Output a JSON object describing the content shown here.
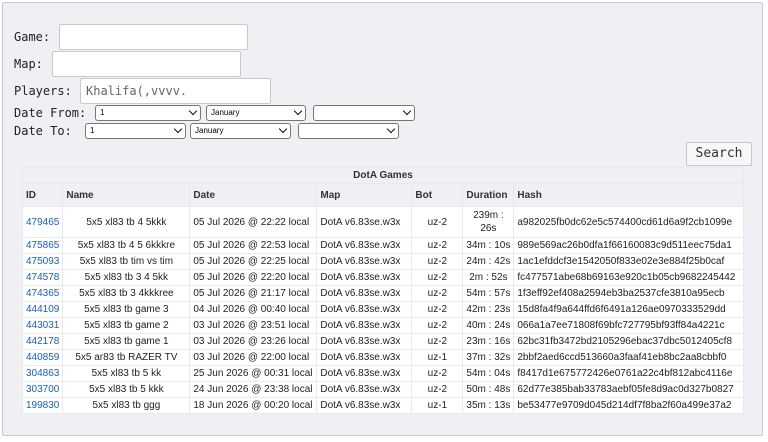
{
  "form": {
    "game_label": "Game:",
    "map_label": "Map:",
    "players_label": "Players:",
    "players_value": "Khalifa(,vvvv.",
    "date_from_label": "Date From:",
    "date_to_label": "Date To:",
    "date_from": {
      "day": "1",
      "month": "January",
      "year": ""
    },
    "date_to": {
      "day": "1",
      "month": "January",
      "year": ""
    },
    "search_label": "Search"
  },
  "table": {
    "caption": "DotA Games",
    "headers": {
      "id": "ID",
      "name": "Name",
      "date": "Date",
      "map": "Map",
      "bot": "Bot",
      "duration": "Duration",
      "hash": "Hash"
    },
    "rows": [
      {
        "id": "479465",
        "name": "5x5 xl83 tb 4 5kkk",
        "date": "05 Jul 2026 @ 22:22 local",
        "map": "DotA v6.83se.w3x",
        "bot": "uz-2",
        "duration": "239m :\n26s",
        "hash": "a982025fb0dc62e5c574400cd61d6a9f2cb1099e"
      },
      {
        "id": "475865",
        "name": "5x5 xl83 tb 4 5 6kkkre",
        "date": "05 Jul 2026 @ 22:53 local",
        "map": "DotA v6.83se.w3x",
        "bot": "uz-2",
        "duration": "34m : 10s",
        "hash": "989e569ac26b0dfa1f66160083c9d511eec75da1"
      },
      {
        "id": "475093",
        "name": "5x5 xl83 tb tim vs tim",
        "date": "05 Jul 2026 @ 22:25 local",
        "map": "DotA v6.83se.w3x",
        "bot": "uz-2",
        "duration": "24m : 42s",
        "hash": "1ac1efddcf3e1542050f833e02e3e884f25b0caf"
      },
      {
        "id": "474578",
        "name": "5x5 xl83 tb 3 4 5kk",
        "date": "05 Jul 2026 @ 22:20 local",
        "map": "DotA v6.83se.w3x",
        "bot": "uz-2",
        "duration": "2m : 52s",
        "hash": "fc477571abe68b69163e920c1b05cb9682245442"
      },
      {
        "id": "474365",
        "name": "5x5 xl83 tb 3 4kkkree",
        "date": "05 Jul 2026 @ 21:17 local",
        "map": "DotA v6.83se.w3x",
        "bot": "uz-2",
        "duration": "54m : 57s",
        "hash": "1f3eff92ef408a2594eb3ba2537cfe3810a95ecb"
      },
      {
        "id": "444109",
        "name": "5x5 xl83 tb game 3",
        "date": "04 Jul 2026 @ 00:40 local",
        "map": "DotA v6.83se.w3x",
        "bot": "uz-2",
        "duration": "42m : 23s",
        "hash": "15d8fa4f9a644ffd6f6491a126ae0970333529dd"
      },
      {
        "id": "443031",
        "name": "5x5 xl83 tb game 2",
        "date": "03 Jul 2026 @ 23:51 local",
        "map": "DotA v6.83se.w3x",
        "bot": "uz-2",
        "duration": "40m : 24s",
        "hash": "066a1a7ee71808f69bfc727795bf93ff84a4221c"
      },
      {
        "id": "442178",
        "name": "5x5 xl83 tb game 1",
        "date": "03 Jul 2026 @ 23:26 local",
        "map": "DotA v6.83se.w3x",
        "bot": "uz-2",
        "duration": "23m : 16s",
        "hash": "62bc31fb3472bd2105296ebac37dbc5012405cf8"
      },
      {
        "id": "440859",
        "name": "5x5 ar83 tb RAZER TV",
        "date": "03 Jul 2026 @ 22:00 local",
        "map": "DotA v6.83se.w3x",
        "bot": "uz-1",
        "duration": "37m : 32s",
        "hash": "2bbf2aed6ccd513660a3faaf41eb8bc2aa8cbbf0"
      },
      {
        "id": "304863",
        "name": "5x5 xl83 tb 5 kk",
        "date": "25 Jun 2026 @ 00:31 local",
        "map": "DotA v6.83se.w3x",
        "bot": "uz-2",
        "duration": "54m : 04s",
        "hash": "f8417d1e675772426e0761a22c4bf812abc4116e"
      },
      {
        "id": "303700",
        "name": "5x5 xl83 tb 5 kkk",
        "date": "24 Jun 2026 @ 23:38 local",
        "map": "DotA v6.83se.w3x",
        "bot": "uz-2",
        "duration": "50m : 48s",
        "hash": "62d77e385bab33783aebf05fe8d9ac0d327b0827"
      },
      {
        "id": "199830",
        "name": "5x5 xl83 tb ggg",
        "date": "18 Jun 2026 @ 00:20 local",
        "map": "DotA v6.83se.w3x",
        "bot": "uz-1",
        "duration": "35m : 13s",
        "hash": "be53477e9709d045d214df7f8ba2f60a499e37a2"
      }
    ]
  }
}
